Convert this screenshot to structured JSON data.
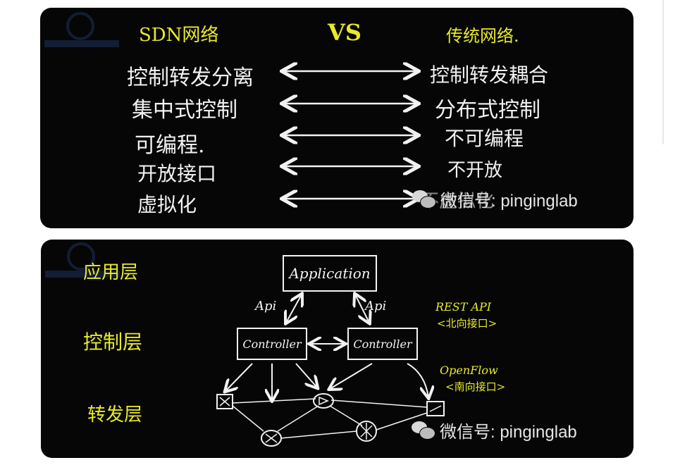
{
  "top_panel": {
    "header_left": "SDN网络",
    "header_middle": "VS",
    "header_right": "传统网络.",
    "rows": [
      {
        "left": "控制转发分离",
        "right": "控制转发耦合"
      },
      {
        "left": "集中式控制",
        "right": "分布式控制"
      },
      {
        "left": "可编程.",
        "right": "不可编程"
      },
      {
        "left": "开放接口",
        "right": "不开放"
      },
      {
        "left": "虚拟化",
        "right": "不虚拟化"
      }
    ],
    "watermark": "微信号: pinginglab"
  },
  "bottom_panel": {
    "layers": {
      "application": "应用层",
      "control": "控制层",
      "forwarding": "转发层"
    },
    "application_box": "Application",
    "controller_left": "Controller",
    "controller_right": "Controller",
    "api_left": "Api",
    "api_right": "Api",
    "rest_api": "REST API",
    "northbound": "<北向接口>",
    "openflow": "OpenFlow",
    "southbound": "<南向接口>",
    "watermark": "微信号: pinginglab"
  },
  "colors": {
    "board": "#060606",
    "chalk": "#f2f2f2",
    "highlight": "#e8ea2a"
  }
}
